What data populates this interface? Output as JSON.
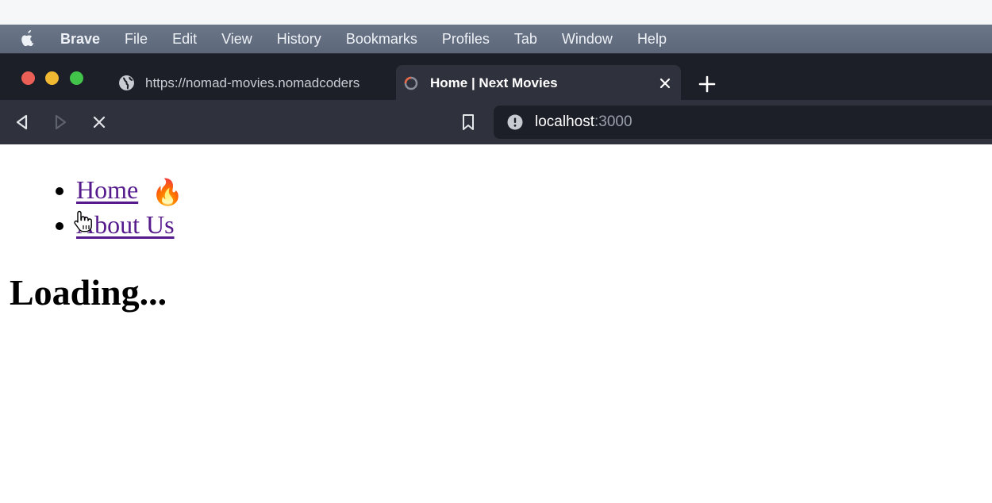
{
  "menubar": {
    "app_name": "Brave",
    "items": [
      "File",
      "Edit",
      "View",
      "History",
      "Bookmarks",
      "Profiles",
      "Tab",
      "Window",
      "Help"
    ]
  },
  "tabs": {
    "inactive": {
      "title": "https://nomad-movies.nomadcoders",
      "icon": "globe-icon"
    },
    "active": {
      "title": "Home | Next Movies",
      "icon": "loading-favicon-icon"
    }
  },
  "urlbar": {
    "host": "localhost",
    "port": ":3000",
    "icon": "info-icon"
  },
  "page": {
    "nav": [
      {
        "label": "Home",
        "emoji": "🔥"
      },
      {
        "label": "About Us"
      }
    ],
    "heading": "Loading..."
  },
  "colors": {
    "menubar": "#606b7d",
    "tabbar": "#1c1f27",
    "toolbar": "#2f323c",
    "link": "#551a8b",
    "traffic_red": "#ec5f56",
    "traffic_yellow": "#f1b832",
    "traffic_green": "#42c44a"
  }
}
